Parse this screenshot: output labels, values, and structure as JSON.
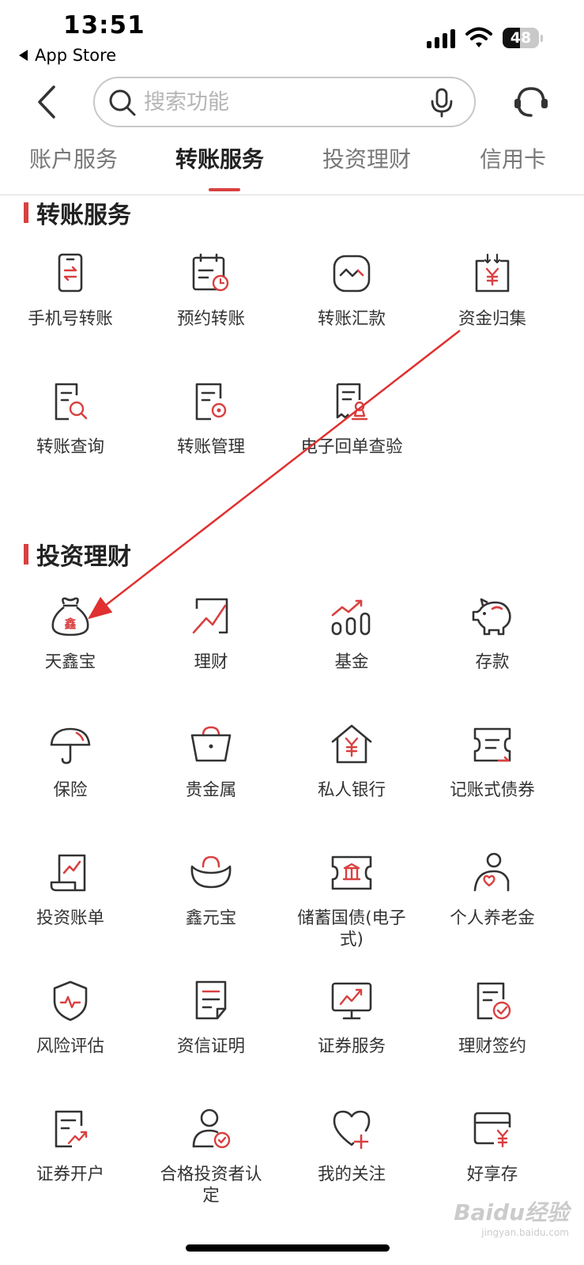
{
  "status_bar": {
    "time": "13:51",
    "back_app": "App Store",
    "battery": "48",
    "battery_level": 0.48
  },
  "search": {
    "placeholder": "搜索功能",
    "value": ""
  },
  "tabs": [
    {
      "label": "账户服务"
    },
    {
      "label": "转账服务",
      "active": true
    },
    {
      "label": "投资理财"
    },
    {
      "label": "信用卡"
    }
  ],
  "sections": [
    {
      "title": "转账服务",
      "items": [
        {
          "label": "手机号转账",
          "icon": "phone-transfer-icon"
        },
        {
          "label": "预约转账",
          "icon": "scheduled-transfer-icon"
        },
        {
          "label": "转账汇款",
          "icon": "remittance-icon"
        },
        {
          "label": "资金归集",
          "icon": "fund-collection-icon"
        },
        {
          "label": "转账查询",
          "icon": "transfer-query-icon"
        },
        {
          "label": "转账管理",
          "icon": "transfer-management-icon"
        },
        {
          "label": "电子回单查验",
          "icon": "e-receipt-icon"
        }
      ]
    },
    {
      "title": "投资理财",
      "items": [
        {
          "label": "天鑫宝",
          "icon": "money-bag-icon",
          "glyph": "鑫"
        },
        {
          "label": "理财",
          "icon": "trend-icon"
        },
        {
          "label": "基金",
          "icon": "fund-chart-icon"
        },
        {
          "label": "存款",
          "icon": "piggy-bank-icon"
        },
        {
          "label": "保险",
          "icon": "umbrella-icon"
        },
        {
          "label": "贵金属",
          "icon": "basket-icon"
        },
        {
          "label": "私人银行",
          "icon": "house-yen-icon"
        },
        {
          "label": "记账式债券",
          "icon": "bond-ticket-icon"
        },
        {
          "label": "投资账单",
          "icon": "investment-bill-icon"
        },
        {
          "label": "鑫元宝",
          "icon": "gold-ingot-icon"
        },
        {
          "label": "储蓄国债(电子式)",
          "icon": "national-bond-icon"
        },
        {
          "label": "个人养老金",
          "icon": "pension-icon"
        },
        {
          "label": "风险评估",
          "icon": "shield-pulse-icon"
        },
        {
          "label": "资信证明",
          "icon": "credit-certificate-icon"
        },
        {
          "label": "证券服务",
          "icon": "monitor-chart-icon"
        },
        {
          "label": "理财签约",
          "icon": "sign-contract-icon"
        },
        {
          "label": "证券开户",
          "icon": "securities-account-icon"
        },
        {
          "label": "合格投资者认定",
          "icon": "qualified-investor-icon"
        },
        {
          "label": "我的关注",
          "icon": "heart-plus-icon"
        },
        {
          "label": "好享存",
          "icon": "card-yen-icon"
        }
      ]
    }
  ],
  "watermark": {
    "logo": "Baidu经验",
    "url": "jingyan.baidu.com"
  },
  "colors": {
    "accent": "#d94040",
    "icon_stroke": "#333333",
    "text": "#333333"
  }
}
